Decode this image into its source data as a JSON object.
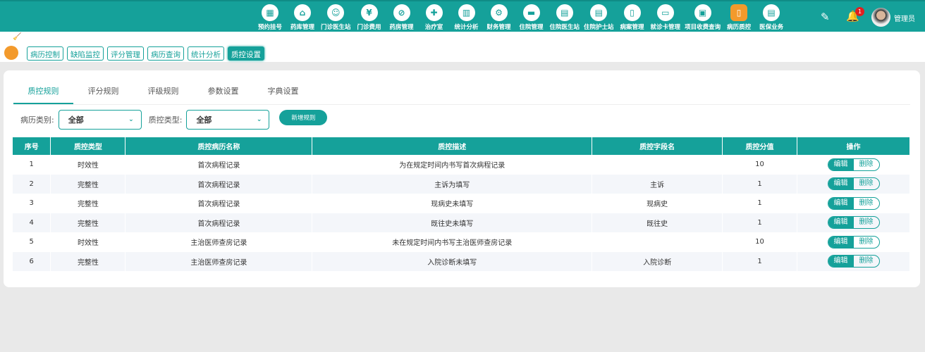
{
  "nav": [
    {
      "label": "预约挂号",
      "icon": "calendar-icon"
    },
    {
      "label": "药库管理",
      "icon": "warehouse-icon"
    },
    {
      "label": "门诊医生站",
      "icon": "doctor-icon"
    },
    {
      "label": "门诊费用",
      "icon": "yuan-icon"
    },
    {
      "label": "药房管理",
      "icon": "pill-icon"
    },
    {
      "label": "治疗室",
      "icon": "nurse-icon"
    },
    {
      "label": "统计分析",
      "icon": "chart-icon"
    },
    {
      "label": "财务管理",
      "icon": "gear-icon"
    },
    {
      "label": "住院管理",
      "icon": "bed-icon"
    },
    {
      "label": "住院医生站",
      "icon": "doctor-card-icon"
    },
    {
      "label": "住院护士站",
      "icon": "nurse-card-icon"
    },
    {
      "label": "病案管理",
      "icon": "file-icon"
    },
    {
      "label": "就诊卡管理",
      "icon": "card-icon"
    },
    {
      "label": "项目收费查询",
      "icon": "search-doc-icon"
    },
    {
      "label": "病历质控",
      "icon": "record-icon"
    },
    {
      "label": "医保业务",
      "icon": "insurance-icon"
    }
  ],
  "header": {
    "notifications": "1",
    "user": "管理员"
  },
  "subtabs": [
    "病历控制",
    "缺陷监控",
    "评分管理",
    "病历查询",
    "统计分析",
    "质控设置"
  ],
  "tabs": [
    "质控规则",
    "评分规则",
    "评级规则",
    "参数设置",
    "字典设置"
  ],
  "filters": {
    "category_label": "病历类别:",
    "category_value": "全部",
    "type_label": "质控类型:",
    "type_value": "全部",
    "add_button": "新增规则"
  },
  "table": {
    "headers": [
      "序号",
      "质控类型",
      "质控病历名称",
      "质控描述",
      "质控字段名",
      "质控分值",
      "操作"
    ],
    "rows": [
      [
        "1",
        "时效性",
        "首次病程记录",
        "为在规定时间内书写首次病程记录",
        "",
        "10"
      ],
      [
        "2",
        "完整性",
        "首次病程记录",
        "主诉为填写",
        "主诉",
        "1"
      ],
      [
        "3",
        "完整性",
        "首次病程记录",
        "现病史未填写",
        "现病史",
        "1"
      ],
      [
        "4",
        "完整性",
        "首次病程记录",
        "既往史未填写",
        "既往史",
        "1"
      ],
      [
        "5",
        "时效性",
        "主治医师查房记录",
        "未在规定时间内书写主治医师查房记录",
        "",
        "10"
      ],
      [
        "6",
        "完整性",
        "主治医师查房记录",
        "入院诊断未填写",
        "入院诊断",
        "1"
      ]
    ],
    "edit": "编辑",
    "delete": "删除"
  },
  "colors": {
    "primary": "#15a19a",
    "accent": "#f39a2c"
  }
}
